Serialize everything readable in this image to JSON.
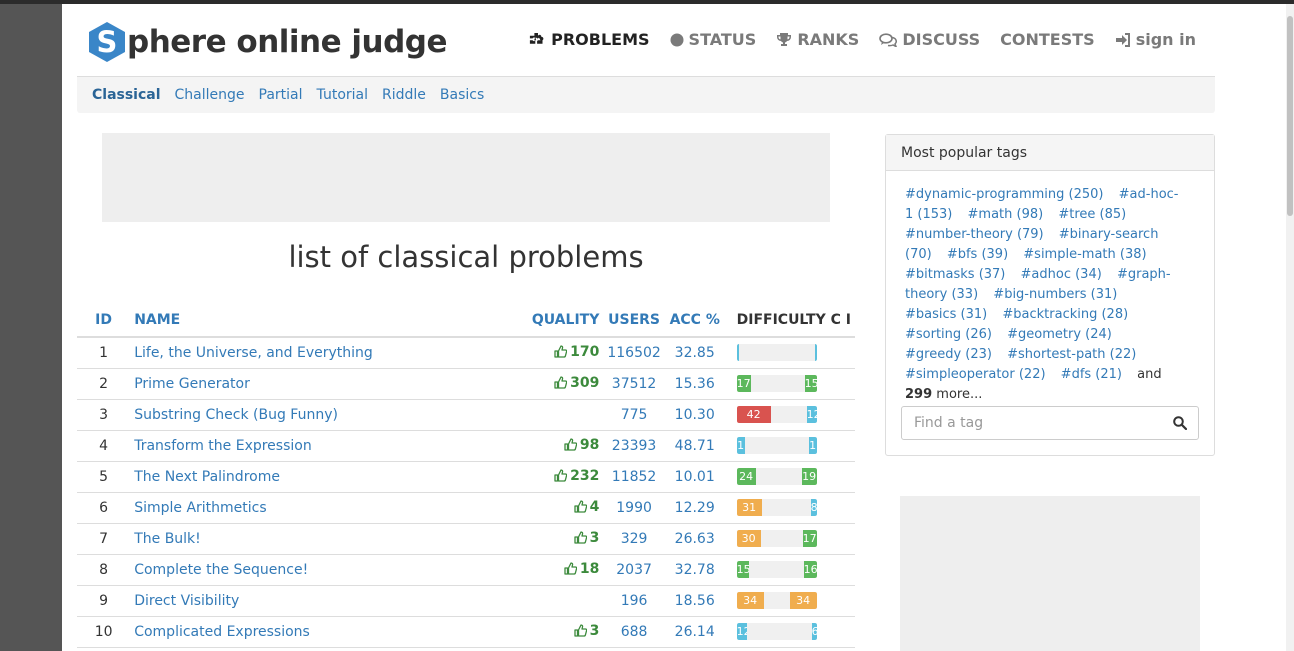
{
  "header": {
    "logo_letter": "S",
    "logo_rest": "phere online judge",
    "nav": [
      {
        "label": "PROBLEMS",
        "icon": "puzzle-icon",
        "active": true
      },
      {
        "label": "STATUS",
        "icon": "circle-icon",
        "active": false
      },
      {
        "label": "RANKS",
        "icon": "trophy-icon",
        "active": false
      },
      {
        "label": "DISCUSS",
        "icon": "comments-icon",
        "active": false
      },
      {
        "label": "CONTESTS",
        "icon": "",
        "active": false
      },
      {
        "label": "sign in",
        "icon": "sign-in-icon",
        "active": false
      }
    ]
  },
  "subnav": [
    "Classical",
    "Challenge",
    "Partial",
    "Tutorial",
    "Riddle",
    "Basics"
  ],
  "page_title": "list of classical problems",
  "table": {
    "headers": {
      "id": "ID",
      "name": "NAME",
      "quality": "QUALITY",
      "users": "USERS",
      "acc": "ACC %",
      "difficulty": "DIFFICULTY C I"
    },
    "rows": [
      {
        "id": "1",
        "name": "Life, the Universe, and Everything",
        "quality": "170",
        "users": "116502",
        "acc": "32.85",
        "dl": "",
        "dr": "",
        "dl_frac": 0.03,
        "dr_frac": 0.03,
        "dl_color": "#5bc0de",
        "dr_color": "#5bc0de"
      },
      {
        "id": "2",
        "name": "Prime Generator",
        "quality": "309",
        "users": "37512",
        "acc": "15.36",
        "dl": "17",
        "dr": "15",
        "dl_frac": 0.17,
        "dr_frac": 0.15,
        "dl_color": "#5cb85c",
        "dr_color": "#5cb85c"
      },
      {
        "id": "3",
        "name": "Substring Check (Bug Funny)",
        "quality": "",
        "users": "775",
        "acc": "10.30",
        "dl": "42",
        "dr": "12",
        "dl_frac": 0.42,
        "dr_frac": 0.12,
        "dl_color": "#d9534f",
        "dr_color": "#5bc0de"
      },
      {
        "id": "4",
        "name": "Transform the Expression",
        "quality": "98",
        "users": "23393",
        "acc": "48.71",
        "dl": "1",
        "dr": "1",
        "dl_frac": 0.1,
        "dr_frac": 0.1,
        "dl_color": "#5bc0de",
        "dr_color": "#5bc0de"
      },
      {
        "id": "5",
        "name": "The Next Palindrome",
        "quality": "232",
        "users": "11852",
        "acc": "10.01",
        "dl": "24",
        "dr": "19",
        "dl_frac": 0.24,
        "dr_frac": 0.19,
        "dl_color": "#5cb85c",
        "dr_color": "#5cb85c"
      },
      {
        "id": "6",
        "name": "Simple Arithmetics",
        "quality": "4",
        "users": "1990",
        "acc": "12.29",
        "dl": "31",
        "dr": "8",
        "dl_frac": 0.31,
        "dr_frac": 0.08,
        "dl_color": "#f0ad4e",
        "dr_color": "#5bc0de"
      },
      {
        "id": "7",
        "name": "The Bulk!",
        "quality": "3",
        "users": "329",
        "acc": "26.63",
        "dl": "30",
        "dr": "17",
        "dl_frac": 0.3,
        "dr_frac": 0.17,
        "dl_color": "#f0ad4e",
        "dr_color": "#5cb85c"
      },
      {
        "id": "8",
        "name": "Complete the Sequence!",
        "quality": "18",
        "users": "2037",
        "acc": "32.78",
        "dl": "15",
        "dr": "16",
        "dl_frac": 0.15,
        "dr_frac": 0.16,
        "dl_color": "#5cb85c",
        "dr_color": "#5cb85c"
      },
      {
        "id": "9",
        "name": "Direct Visibility",
        "quality": "",
        "users": "196",
        "acc": "18.56",
        "dl": "34",
        "dr": "34",
        "dl_frac": 0.34,
        "dr_frac": 0.34,
        "dl_color": "#f0ad4e",
        "dr_color": "#f0ad4e"
      },
      {
        "id": "10",
        "name": "Complicated Expressions",
        "quality": "3",
        "users": "688",
        "acc": "26.14",
        "dl": "12",
        "dr": "6",
        "dl_frac": 0.12,
        "dr_frac": 0.06,
        "dl_color": "#5bc0de",
        "dr_color": "#5bc0de"
      }
    ]
  },
  "sidebar": {
    "title": "Most popular tags",
    "tags": [
      "#dynamic-programming (250)",
      "#ad-hoc-1 (153)",
      "#math (98)",
      "#tree (85)",
      "#number-theory (79)",
      "#binary-search (70)",
      "#bfs (39)",
      "#simple-math (38)",
      "#bitmasks (37)",
      "#adhoc (34)",
      "#graph-theory (33)",
      "#big-numbers (31)",
      "#basics (31)",
      "#backtracking (28)",
      "#sorting (26)",
      "#geometry (24)",
      "#greedy (23)",
      "#shortest-path (22)",
      "#simpleoperator (22)",
      "#dfs (21)"
    ],
    "more_prefix": "and",
    "more_count": "299",
    "more_suffix": "more...",
    "search_placeholder": "Find a tag"
  },
  "colors": {
    "link": "#337ab7",
    "quality": "#3c8a3c",
    "logo": "#3a86c8"
  }
}
